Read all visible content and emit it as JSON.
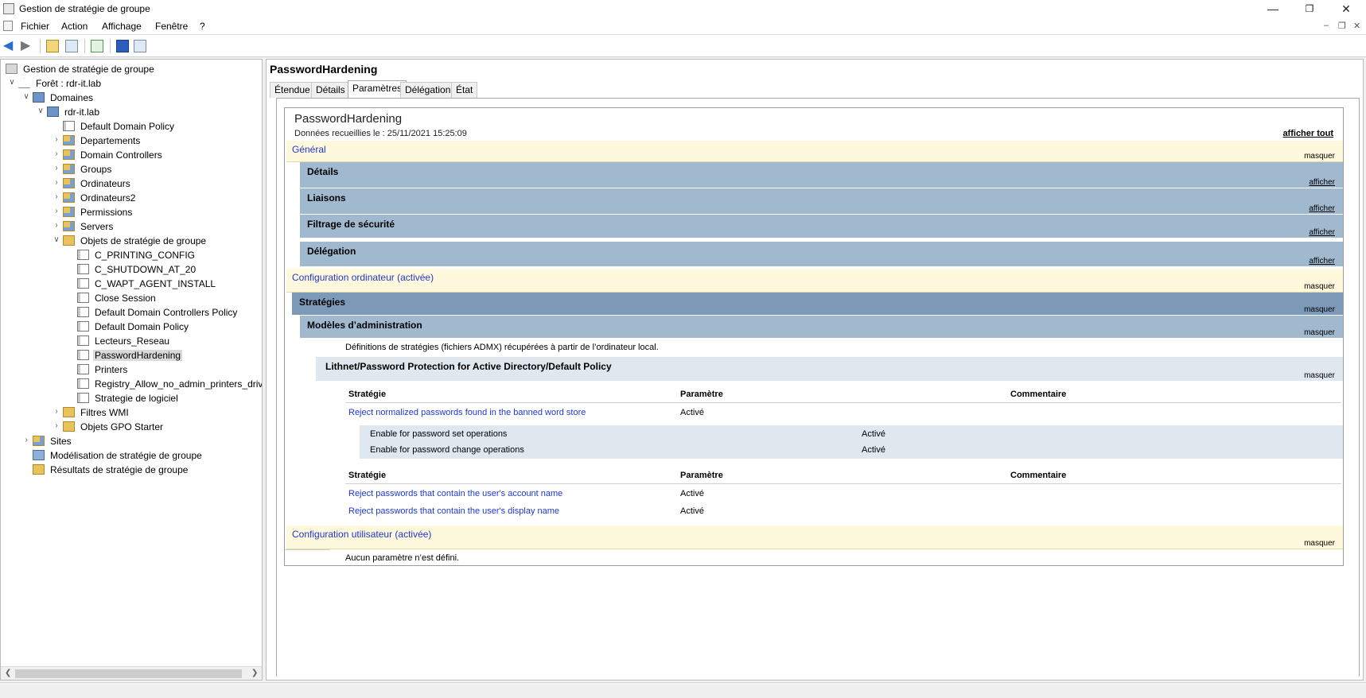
{
  "window": {
    "title": "Gestion de stratégie de groupe",
    "minimize": "—",
    "restore": "❐",
    "close": "✕"
  },
  "menu": [
    "Fichier",
    "Action",
    "Affichage",
    "Fenêtre",
    "?"
  ],
  "mdi_controls": {
    "minimize": "–",
    "restore": "❐",
    "close": "✕"
  },
  "toolbar": [
    "back-icon",
    "forward-icon",
    "up-folder-icon",
    "show-hide-tree-icon",
    "refresh-icon",
    "help-icon",
    "view-icon"
  ],
  "tree": {
    "root": "Gestion de stratégie de groupe",
    "forest": "Forêt : rdr-it.lab",
    "domains": "Domaines",
    "domain": "rdr-it.lab",
    "domain_children": [
      "Default Domain Policy",
      "Departements",
      "Domain Controllers",
      "Groups",
      "Ordinateurs",
      "Ordinateurs2",
      "Permissions",
      "Servers",
      "Objets de stratégie de groupe"
    ],
    "gpos": [
      "C_PRINTING_CONFIG",
      "C_SHUTDOWN_AT_20",
      "C_WAPT_AGENT_INSTALL",
      "Close Session",
      "Default Domain Controllers Policy",
      "Default Domain Policy",
      "Lecteurs_Reseau",
      "PasswordHardening",
      "Printers",
      "Registry_Allow_no_admin_printers_drive",
      "Strategie de logiciel"
    ],
    "after_gpos": [
      "Filtres WMI",
      "Objets GPO Starter"
    ],
    "sites": "Sites",
    "modeling": "Modélisation de stratégie de groupe",
    "results": "Résultats de stratégie de groupe"
  },
  "right": {
    "title": "PasswordHardening",
    "tabs": [
      "Étendue",
      "Détails",
      "Paramètres",
      "Délégation",
      "État"
    ],
    "active_tab": "Paramètres"
  },
  "report": {
    "title": "PasswordHardening",
    "date": "Données recueillies le : 25/11/2021 15:25:09",
    "show_all": "afficher tout",
    "hide": "masquer",
    "show": "afficher",
    "general": "Général",
    "details": "Détails",
    "links": "Liaisons",
    "security_filtering": "Filtrage de sécurité",
    "delegation": "Délégation",
    "computer_config": "Configuration ordinateur (activée)",
    "policies": "Stratégies",
    "admin_templates": "Modèles d’administration",
    "admx_note": "Définitions de stratégies (fichiers ADMX) récupérées à partir de l’ordinateur local.",
    "category": "Lithnet/Password Protection for Active Directory/Default Policy",
    "col_policy": "Stratégie",
    "col_setting": "Paramètre",
    "col_comment": "Commentaire",
    "table1": [
      {
        "policy": "Reject normalized passwords found in the banned word store",
        "setting": "Activé"
      }
    ],
    "subrows": [
      {
        "label": "Enable for password set operations",
        "value": "Activé"
      },
      {
        "label": "Enable for password change operations",
        "value": "Activé"
      }
    ],
    "table2": [
      {
        "policy": "Reject passwords that contain the user's account name",
        "setting": "Activé"
      },
      {
        "policy": "Reject passwords that contain the user's display name",
        "setting": "Activé"
      }
    ],
    "user_config": "Configuration utilisateur (activée)",
    "no_settings": "Aucun paramètre n’est défini."
  }
}
